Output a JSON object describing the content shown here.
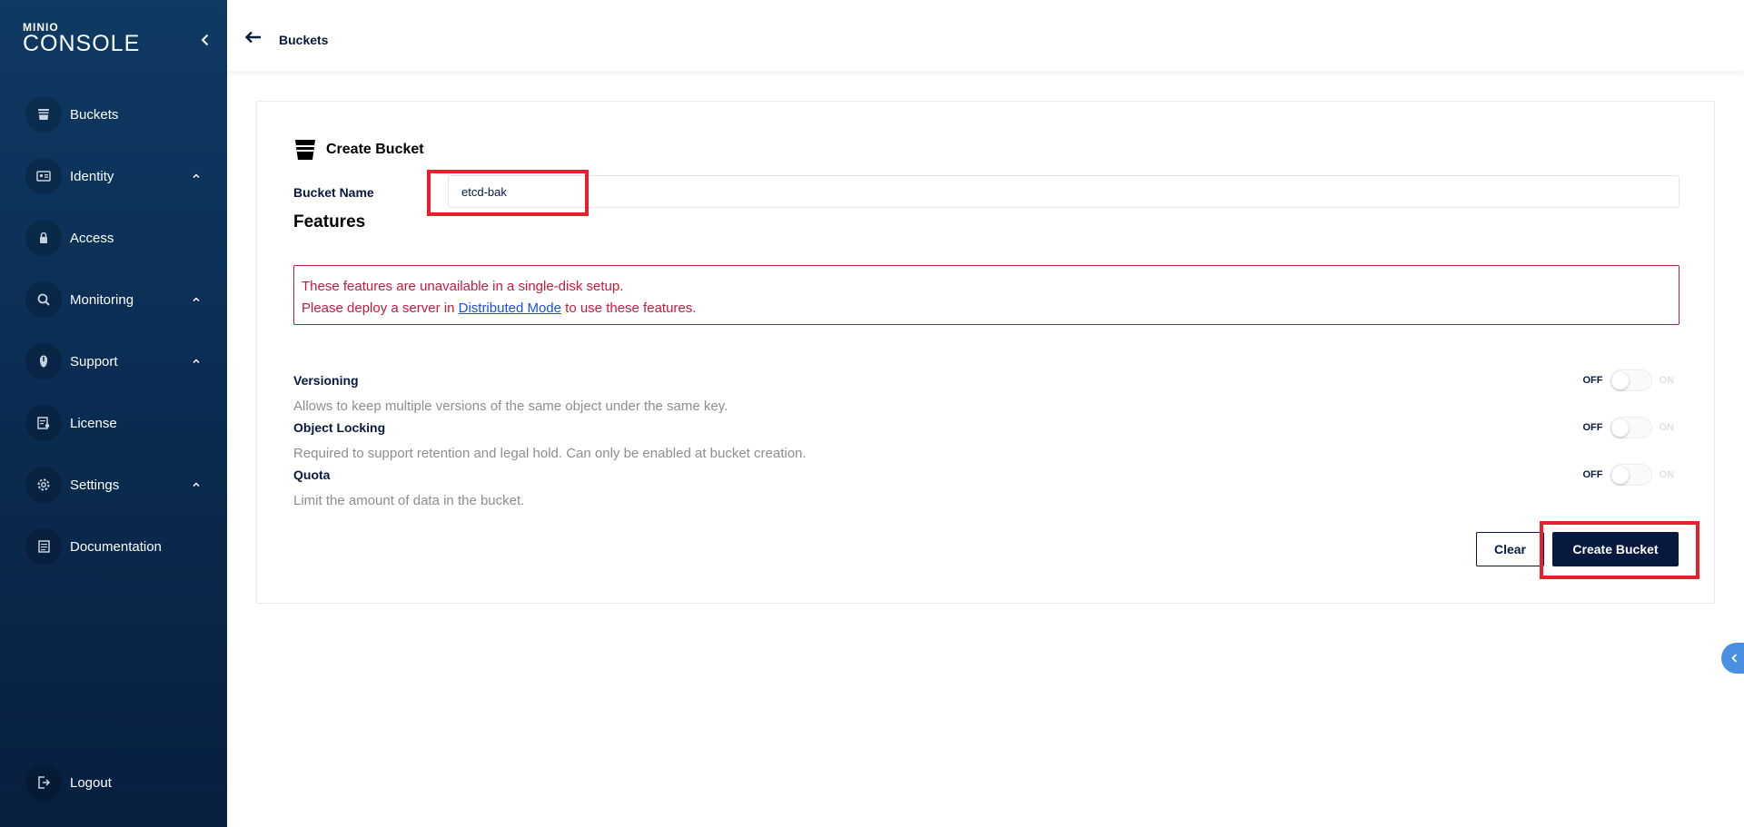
{
  "app": {
    "logo_small": "MINIO",
    "logo_big": "CONSOLE"
  },
  "sidebar": {
    "items": [
      {
        "label": "Buckets",
        "icon": "bucket-icon",
        "expandable": false
      },
      {
        "label": "Identity",
        "icon": "id-card-icon",
        "expandable": true
      },
      {
        "label": "Access",
        "icon": "lock-icon",
        "expandable": false
      },
      {
        "label": "Monitoring",
        "icon": "magnifier-icon",
        "expandable": true
      },
      {
        "label": "Support",
        "icon": "support-icon",
        "expandable": true
      },
      {
        "label": "License",
        "icon": "license-icon",
        "expandable": false
      },
      {
        "label": "Settings",
        "icon": "gear-icon",
        "expandable": true
      },
      {
        "label": "Documentation",
        "icon": "document-icon",
        "expandable": false
      }
    ],
    "logout_label": "Logout"
  },
  "header": {
    "breadcrumb": "Buckets"
  },
  "form": {
    "title": "Create Bucket",
    "bucket_name_label": "Bucket Name",
    "bucket_name_value": "etcd-bak",
    "features_title": "Features",
    "alert": {
      "line1": "These features are unavailable in a single-disk setup.",
      "line2_prefix": "Please deploy a server in ",
      "line2_link": "Distributed Mode",
      "line2_suffix": " to use these features."
    },
    "features": [
      {
        "name": "Versioning",
        "description": "Allows to keep multiple versions of the same object under the same key.",
        "off_label": "OFF",
        "on_label": "ON",
        "enabled": false
      },
      {
        "name": "Object Locking",
        "description": "Required to support retention and legal hold. Can only be enabled at bucket creation.",
        "off_label": "OFF",
        "on_label": "ON",
        "enabled": false
      },
      {
        "name": "Quota",
        "description": "Limit the amount of data in the bucket.",
        "off_label": "OFF",
        "on_label": "ON",
        "enabled": false
      }
    ],
    "clear_label": "Clear",
    "create_label": "Create Bucket"
  },
  "colors": {
    "sidebar_bg": "#0b2d53",
    "primary": "#07193e",
    "alert": "#c51b3c",
    "highlight": "#e8202b",
    "link": "#1c4fe0"
  }
}
